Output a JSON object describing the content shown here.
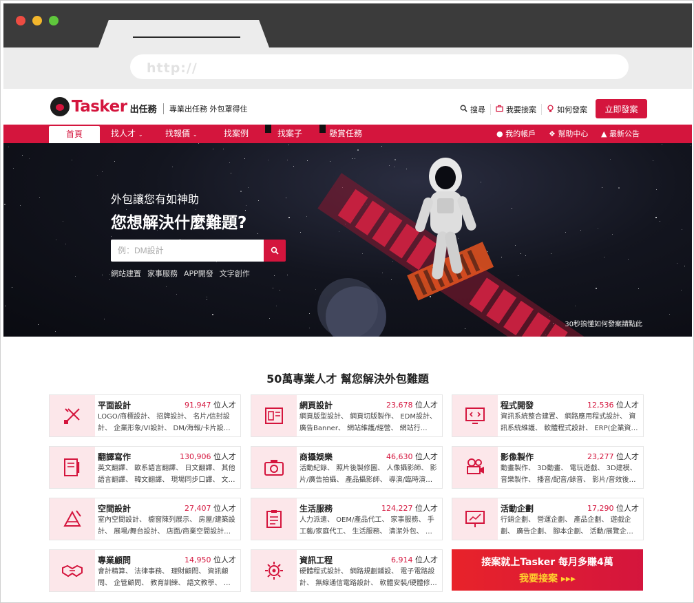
{
  "browser": {
    "url": "http://"
  },
  "header": {
    "logo_text": "Tasker",
    "logo_sub": "出任務",
    "slogan": "專業出任務 外包罩得住",
    "links": [
      {
        "icon": "search-icon",
        "label": "搜尋"
      },
      {
        "icon": "briefcase-icon",
        "label": "我要接案"
      },
      {
        "icon": "lightbulb-icon",
        "label": "如何發案"
      }
    ],
    "post_button": "立即發案"
  },
  "nav": {
    "items": [
      "首頁",
      "找人才",
      "找報價",
      "找案例",
      "找案子",
      "懸賞任務"
    ],
    "right": [
      {
        "icon": "user-icon",
        "label": "我的帳戶"
      },
      {
        "icon": "help-icon",
        "label": "幫助中心"
      },
      {
        "icon": "bell-icon",
        "label": "最新公告"
      }
    ]
  },
  "hero": {
    "subtitle": "外包讓您有如神助",
    "title": "您想解決什麼難題?",
    "search_placeholder": "例：DM設計",
    "tags": [
      "網站建置",
      "家事服務",
      "APP開發",
      "文字創作"
    ],
    "caption": "30秒搞懂如何發案請點此"
  },
  "section": {
    "title": "50萬專業人才 幫您解決外包難題",
    "unit": "位人才",
    "cards": [
      {
        "icon": "pencil-ruler-icon",
        "name": "平面設計",
        "count": "91,947",
        "desc": "LOGO/商標設計、 招牌設計、 名片/信封設計、 企業形象/VI設計、 DM/海報/卡片設…"
      },
      {
        "icon": "webpage-layout-icon",
        "name": "網頁設計",
        "count": "23,678",
        "desc": "網頁版型設計、 網頁切版製作、 EDM設計、 廣告Banner、 網站維護/經營、 網站行…"
      },
      {
        "icon": "code-monitor-icon",
        "name": "程式開發",
        "count": "12,536",
        "desc": "資訊系統整合建置、 網路應用程式設計、 資訊系統維護、 軟體程式設計、 ERP(企業資…"
      },
      {
        "icon": "document-pen-icon",
        "name": "翻譯寫作",
        "count": "130,906",
        "desc": "英文翻譯、 歐系語言翻譯、 日文翻譯、 其他語言翻譯、 韓文翻譯、 現場同步口譯、 文…"
      },
      {
        "icon": "camera-icon",
        "name": "商攝娛樂",
        "count": "46,630",
        "desc": "活動紀錄、 照片後製修圖、 人像攝影師、 影片/廣告拍攝、 產品攝影師、 導演/臨時演…"
      },
      {
        "icon": "film-projector-icon",
        "name": "影像製作",
        "count": "23,277",
        "desc": "動畫製作、 3D動畫、 電玩遊戲、 3D建模、 音樂製作、 播音/配音/錄音、 影片/音效後…"
      },
      {
        "icon": "drafting-tools-icon",
        "name": "空間設計",
        "count": "27,407",
        "desc": "室內空間設計、 櫥窗陳列展示、 房屋/建築設計、 展場/舞台設計、 店面/商業空間設計…"
      },
      {
        "icon": "clipboard-list-icon",
        "name": "生活服務",
        "count": "124,227",
        "desc": "人力派遣、 OEM/產品代工、 家事服務、 手工藝/家庭代工、 生活服務、 清潔外包、 …"
      },
      {
        "icon": "presentation-chart-icon",
        "name": "活動企劃",
        "count": "17,290",
        "desc": "行銷企劃、 營運企劃、 產品企劃、 遊戲企劃、 廣告企劃、 腳本企劃、 活動/展覽企…"
      },
      {
        "icon": "handshake-icon",
        "name": "專業顧問",
        "count": "14,950",
        "desc": "會計精算、 法律事務、 理財顧問、 資訊顧問、 企管顧問、 教育訓練、 語文教學、 …"
      },
      {
        "icon": "gear-chip-icon",
        "name": "資訊工程",
        "count": "6,914",
        "desc": "硬體程式設計、 網路規劃鋪設、 電子電路設計、 無線通信電路設計、 軟體安裝/硬體修…"
      }
    ],
    "promo": {
      "line1": "接案就上Tasker 每月多賺4萬",
      "line2": "我要接案 ▸▸▸"
    }
  },
  "colors": {
    "brand": "#d4153d",
    "promo_accent": "#ffd22e"
  }
}
